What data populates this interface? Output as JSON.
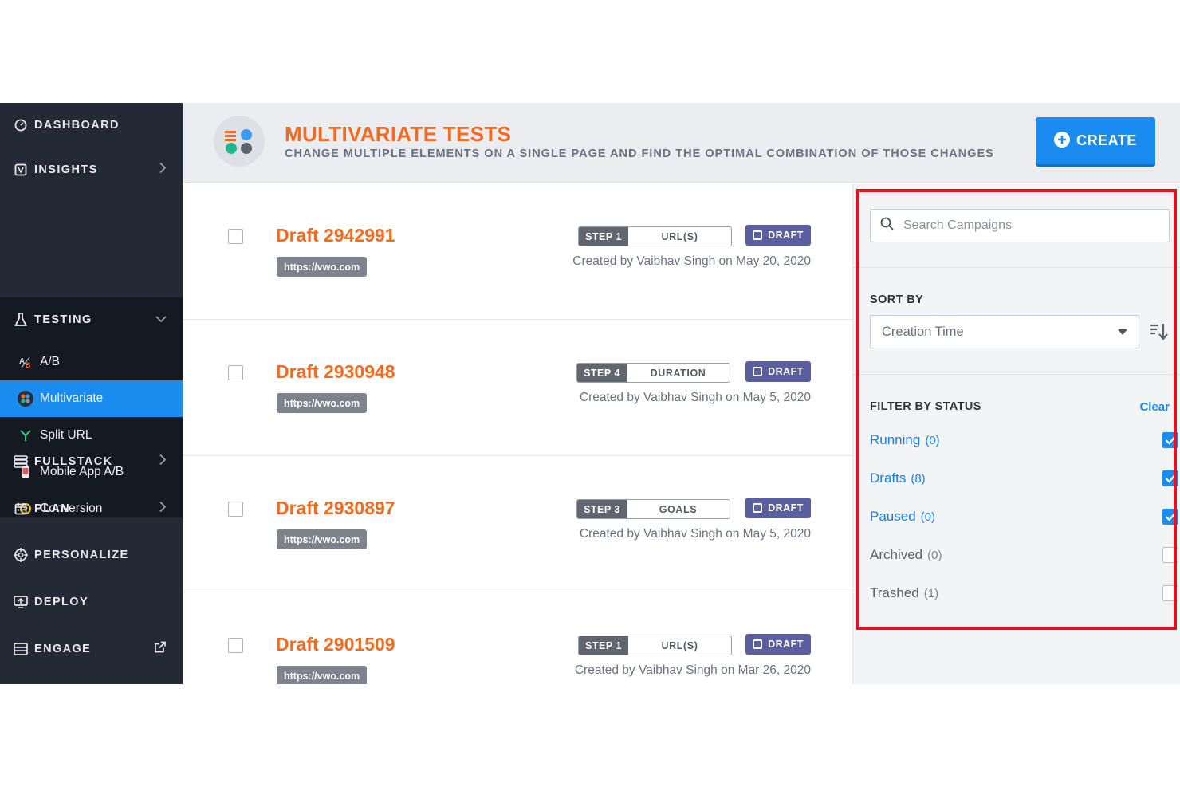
{
  "sidebar": {
    "items": [
      {
        "label": "DASHBOARD",
        "icon": "dashboard-icon"
      },
      {
        "label": "INSIGHTS",
        "icon": "insights-icon"
      },
      {
        "label": "TESTING",
        "icon": "flask-icon"
      },
      {
        "label": "FULLSTACK",
        "icon": "fullstack-icon"
      },
      {
        "label": "PLAN",
        "icon": "calendar-icon"
      },
      {
        "label": "PERSONALIZE",
        "icon": "target-icon"
      },
      {
        "label": "DEPLOY",
        "icon": "deploy-icon"
      },
      {
        "label": "ENGAGE",
        "icon": "engage-icon"
      }
    ],
    "testing_sub": [
      {
        "label": "A/B",
        "icon": "ab-icon"
      },
      {
        "label": "Multivariate",
        "icon": "multivariate-icon"
      },
      {
        "label": "Split URL",
        "icon": "split-url-icon"
      },
      {
        "label": "Mobile App A/B",
        "icon": "mobile-icon"
      },
      {
        "label": "Conversion",
        "icon": "conversion-icon"
      }
    ]
  },
  "header": {
    "title": "MULTIVARIATE TESTS",
    "subtitle": "CHANGE MULTIPLE ELEMENTS ON A SINGLE PAGE AND FIND THE OPTIMAL COMBINATION OF THOSE CHANGES",
    "create_label": "CREATE"
  },
  "campaigns": [
    {
      "name": "Draft 2942991",
      "url": "https://vwo.com",
      "step": "STEP 1",
      "step_name": "URL(S)",
      "status": "DRAFT",
      "created": "Created by Vaibhav Singh on May 20, 2020"
    },
    {
      "name": "Draft 2930948",
      "url": "https://vwo.com",
      "step": "STEP 4",
      "step_name": "DURATION",
      "status": "DRAFT",
      "created": "Created by Vaibhav Singh on May 5, 2020"
    },
    {
      "name": "Draft 2930897",
      "url": "https://vwo.com",
      "step": "STEP 3",
      "step_name": "GOALS",
      "status": "DRAFT",
      "created": "Created by Vaibhav Singh on May 5, 2020"
    },
    {
      "name": "Draft 2901509",
      "url": "https://vwo.com",
      "step": "STEP 1",
      "step_name": "URL(S)",
      "status": "DRAFT",
      "created": "Created by Vaibhav Singh on Mar 26, 2020"
    }
  ],
  "filters": {
    "search_placeholder": "Search Campaigns",
    "sort_label": "SORT BY",
    "sort_value": "Creation Time",
    "filter_label": "FILTER BY STATUS",
    "clear_label": "Clear",
    "statuses": [
      {
        "label": "Running",
        "count": "(0)",
        "checked": true
      },
      {
        "label": "Drafts",
        "count": "(8)",
        "checked": true
      },
      {
        "label": "Paused",
        "count": "(0)",
        "checked": true
      },
      {
        "label": "Archived",
        "count": "(0)",
        "checked": false
      },
      {
        "label": "Trashed",
        "count": "(1)",
        "checked": false
      }
    ]
  },
  "colors": {
    "accent": "#1a8cf0",
    "title_orange": "#f26b21",
    "sidebar_bg": "#232a36",
    "highlight": "#e3101d"
  }
}
